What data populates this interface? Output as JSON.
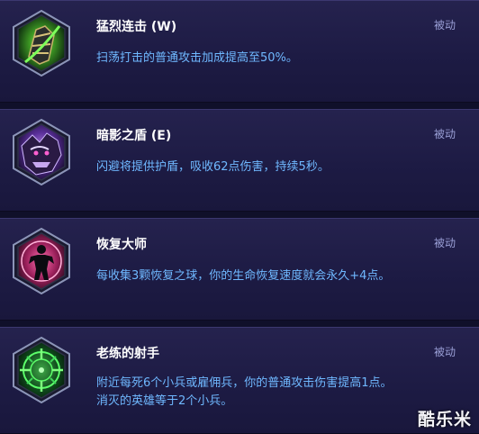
{
  "talents": [
    {
      "title": "猛烈连击 (W)",
      "status": "被动",
      "description": [
        "扫荡打击的普通攻击加成提高至50%。"
      ],
      "icon": "green-armored-fist-icon",
      "accent": "#5ecb3b"
    },
    {
      "title": "暗影之盾 (E)",
      "status": "被动",
      "description": [
        "闪避将提供护盾，吸收62点伤害，持续5秒。"
      ],
      "icon": "purple-shadow-beast-icon",
      "accent": "#8a5ad6"
    },
    {
      "title": "恢复大师",
      "status": "被动",
      "description": [
        "每收集3颗恢复之球，你的生命恢复速度就会永久+4点。"
      ],
      "icon": "regeneration-master-icon",
      "accent": "#c0307a"
    },
    {
      "title": "老练的射手",
      "status": "被动",
      "description": [
        "附近每死6个小兵或雇佣兵，你的普通攻击伤害提高1点。",
        "消灭的英雄等于2个小兵。"
      ],
      "icon": "green-crosshair-icon",
      "accent": "#3fd45a"
    }
  ],
  "watermark": "酷乐米"
}
